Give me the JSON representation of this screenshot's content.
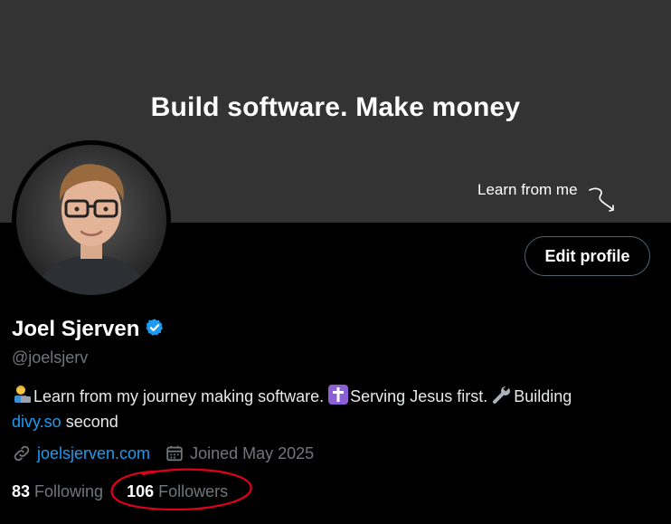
{
  "banner": {
    "headline": "Build software. Make money",
    "cta": "Learn from me"
  },
  "profile": {
    "edit_label": "Edit profile",
    "display_name": "Joel Sjerven",
    "handle": "@joelsjerv",
    "bio_part1": "Learn from my journey making software.",
    "bio_part2": "Serving Jesus first.",
    "bio_part3": "Building",
    "bio_link": "divy.so",
    "bio_part4": "second",
    "website": "joelsjerven.com",
    "joined": "Joined May 2025",
    "following_count": "83",
    "following_label": "Following",
    "followers_count": "106",
    "followers_label": "Followers"
  },
  "colors": {
    "accent": "#1d9bf0",
    "annotation": "#e0001b",
    "banner": "#333333"
  },
  "icons": [
    "verified-badge-icon",
    "technologist-emoji-icon",
    "cross-emoji-icon",
    "wrench-emoji-icon",
    "link-icon",
    "calendar-icon",
    "curly-arrow-icon"
  ]
}
